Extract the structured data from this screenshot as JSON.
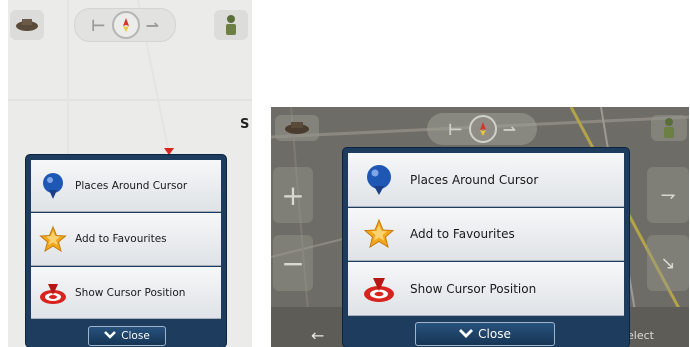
{
  "menu": {
    "items": [
      {
        "label": "Places Around Cursor",
        "icon": "blue-pin-icon"
      },
      {
        "label": "Add to Favourites",
        "icon": "star-icon"
      },
      {
        "label": "Show Cursor Position",
        "icon": "target-icon"
      }
    ],
    "close_label": "Close"
  },
  "left_map": {
    "partial_label": "S"
  },
  "right_map": {
    "bottom_label": "elect"
  },
  "colors": {
    "menu_frame": "#1e3c5e",
    "item_bg": "#e9ecef",
    "close_border": "#9fb5cc",
    "target_red": "#d9231f",
    "star_gold": "#f2a81d"
  }
}
